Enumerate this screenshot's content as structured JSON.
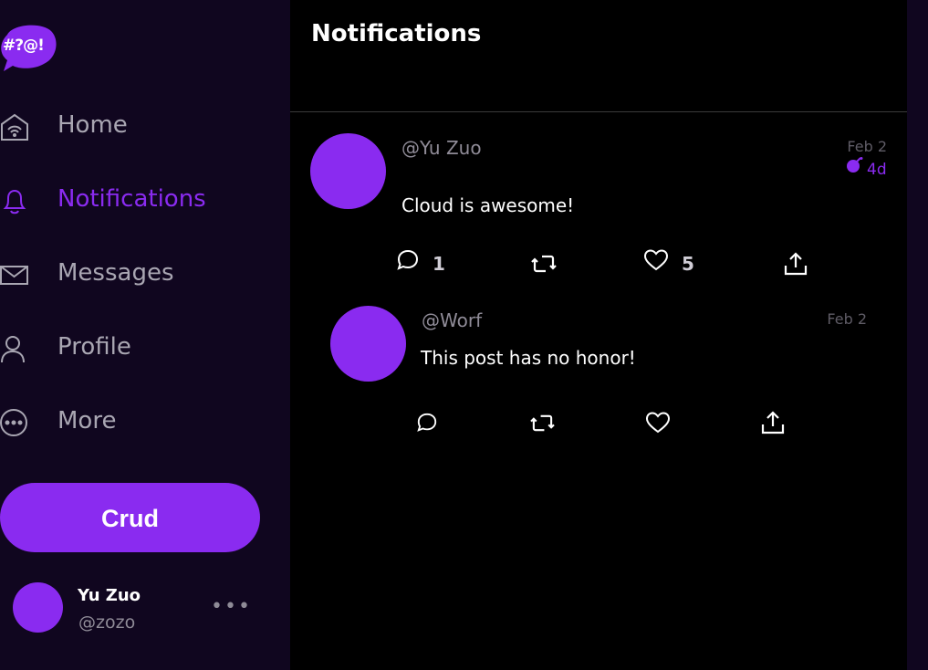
{
  "app": {
    "logo_text": "#?@!"
  },
  "sidebar": {
    "items": [
      {
        "label": "Home",
        "icon": "home-icon"
      },
      {
        "label": "Notifications",
        "icon": "bell-icon",
        "active": true
      },
      {
        "label": "Messages",
        "icon": "envelope-icon"
      },
      {
        "label": "Profile",
        "icon": "user-icon"
      },
      {
        "label": "More",
        "icon": "more-circle-icon"
      }
    ],
    "cta_label": "Crud",
    "account": {
      "name": "Yu Zuo",
      "handle": "@zozo",
      "more_glyph": "•••"
    }
  },
  "main": {
    "title": "Notifications",
    "posts": [
      {
        "handle": "@Yu Zuo",
        "date": "Feb 2",
        "ago": "4d",
        "text": "Cloud is awesome!",
        "reply_count": "1",
        "like_count": "5"
      },
      {
        "handle": "@Worf",
        "date": "Feb 2",
        "text": "This post has no honor!"
      }
    ]
  },
  "colors": {
    "accent": "#8a2bf0",
    "sidebar_bg": "#10061f",
    "main_bg": "#000000",
    "muted_text": "#8f8b97"
  }
}
